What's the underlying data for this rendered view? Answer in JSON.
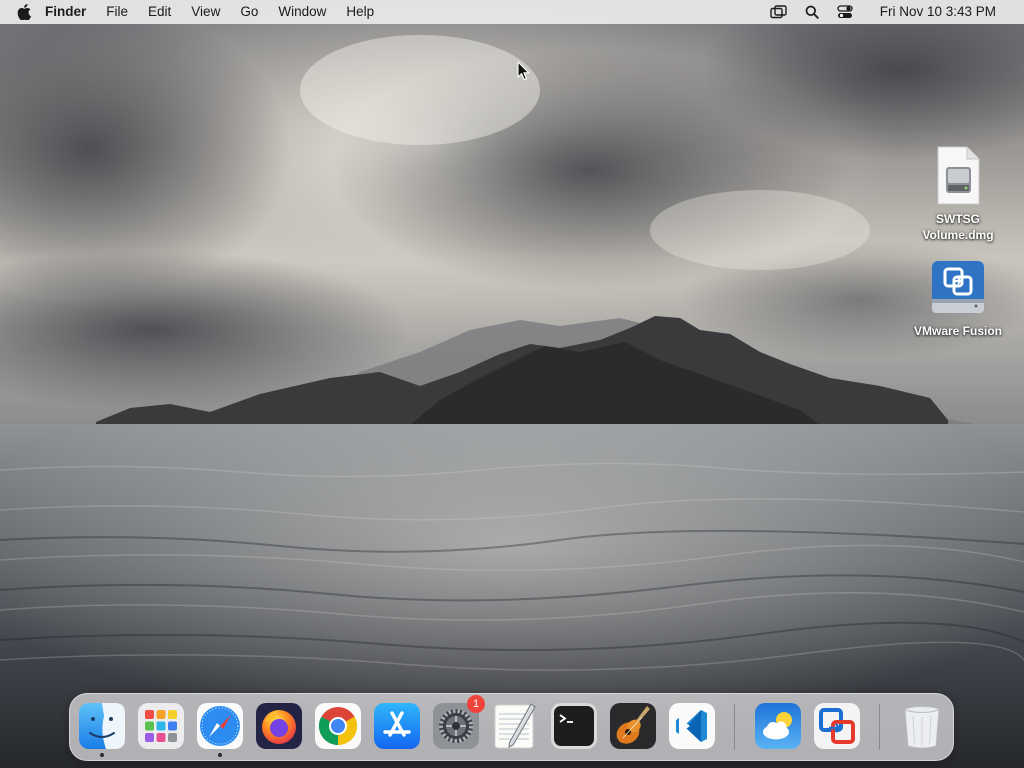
{
  "menubar": {
    "apple_icon": "apple-logo-icon",
    "app_name": "Finder",
    "menus": [
      "File",
      "Edit",
      "View",
      "Go",
      "Window",
      "Help"
    ],
    "status_icons": [
      "screen-mirroring-icon",
      "spotlight-search-icon",
      "control-center-icon"
    ],
    "clock": "Fri Nov 10  3:43 PM"
  },
  "desktop_icons": [
    {
      "label_line1": "SWTSG",
      "label_line2": "Volume.dmg",
      "icon": "disk-image-file-icon"
    },
    {
      "label_line1": "VMware Fusion",
      "label_line2": "",
      "icon": "vmware-volume-icon"
    }
  ],
  "dock": {
    "apps": [
      {
        "name": "Finder",
        "icon": "finder-icon",
        "running": true
      },
      {
        "name": "Launchpad",
        "icon": "launchpad-icon",
        "running": false
      },
      {
        "name": "Safari",
        "icon": "safari-icon",
        "running": true
      },
      {
        "name": "Firefox",
        "icon": "firefox-icon",
        "running": false
      },
      {
        "name": "Google Chrome",
        "icon": "chrome-icon",
        "running": false
      },
      {
        "name": "App Store",
        "icon": "app-store-icon",
        "running": false
      },
      {
        "name": "System Settings",
        "icon": "system-settings-icon",
        "running": false,
        "badge": "1"
      },
      {
        "name": "TextEdit",
        "icon": "textedit-icon",
        "running": false
      },
      {
        "name": "Terminal",
        "icon": "terminal-icon",
        "running": false
      },
      {
        "name": "GarageBand",
        "icon": "garageband-icon",
        "running": false
      },
      {
        "name": "Visual Studio Code",
        "icon": "vscode-icon",
        "running": false
      },
      {
        "name": "Weather",
        "icon": "weather-icon",
        "running": false
      },
      {
        "name": "VMware Fusion",
        "icon": "vmware-fusion-icon",
        "running": false
      },
      {
        "name": "Trash",
        "icon": "trash-icon",
        "running": false
      }
    ]
  },
  "colors": {
    "menubar_bg": "#eceaea",
    "badge": "#f0443a",
    "accent_blue": "#1e7cf2"
  }
}
